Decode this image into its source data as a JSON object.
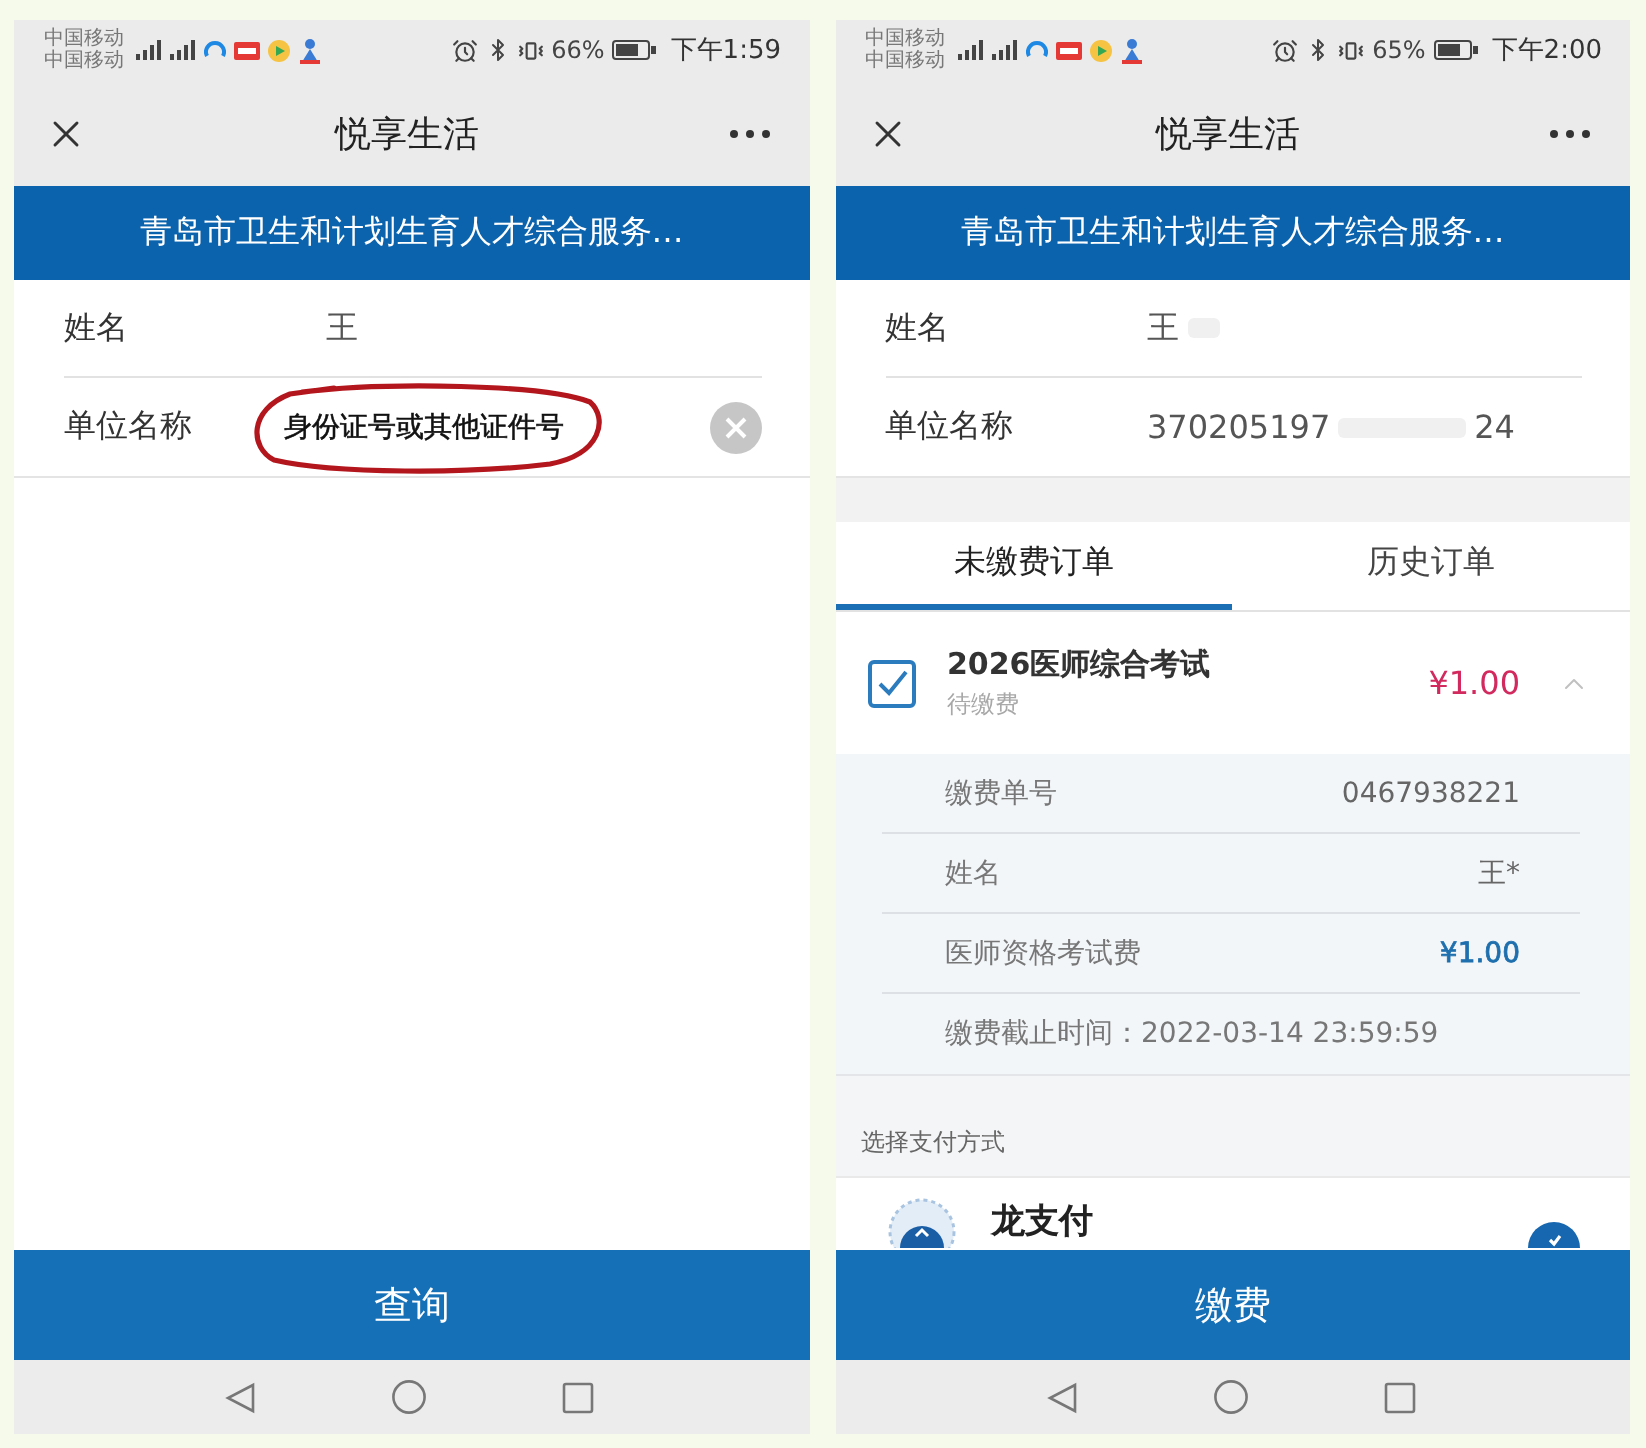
{
  "screens": [
    {
      "status_bar": {
        "carrier": [
          "中国移动",
          "中国移动"
        ],
        "battery": "66%",
        "time": "下午1:59"
      },
      "title": "悦享生活",
      "banner": "青岛市卫生和计划生育人才综合服务…",
      "fields": [
        {
          "label": "姓名",
          "kind": "text",
          "value": "王",
          "redacted": false
        },
        {
          "label": "单位名称",
          "kind": "input",
          "annotation": "身份证号或其他证件号",
          "redacted": false
        }
      ],
      "action_button": "查询"
    },
    {
      "status_bar": {
        "carrier": [
          "中国移动",
          "中国移动"
        ],
        "battery": "65%",
        "time": "下午2:00"
      },
      "title": "悦享生活",
      "banner": "青岛市卫生和计划生育人才综合服务…",
      "fields": [
        {
          "label": "姓名",
          "kind": "text",
          "value": "王",
          "redacted": true
        },
        {
          "label": "单位名称",
          "kind": "text",
          "value": "370205197",
          "value_end": "24",
          "redacted": true
        }
      ],
      "tabs": [
        {
          "label": "未缴费订单",
          "selected": true
        },
        {
          "label": "历史订单",
          "selected": false
        }
      ],
      "order": {
        "checked": true,
        "title": "2026医师综合考试",
        "status": "待缴费",
        "amount": "¥1.00",
        "expanded": true,
        "details": [
          {
            "kind": "pair",
            "label": "缴费单号",
            "value": "0467938221"
          },
          {
            "kind": "pair",
            "label": "姓名",
            "value": "王*"
          },
          {
            "kind": "fee",
            "label": "医师资格考试费",
            "value": "¥1.00"
          },
          {
            "kind": "note",
            "text": "缴费截止时间：2022-03-14 23:59:59"
          }
        ]
      },
      "payment": {
        "heading": "选择支付方式",
        "methods": [
          {
            "name": "龙支付",
            "selected": true
          }
        ]
      },
      "action_button": "缴费"
    }
  ]
}
